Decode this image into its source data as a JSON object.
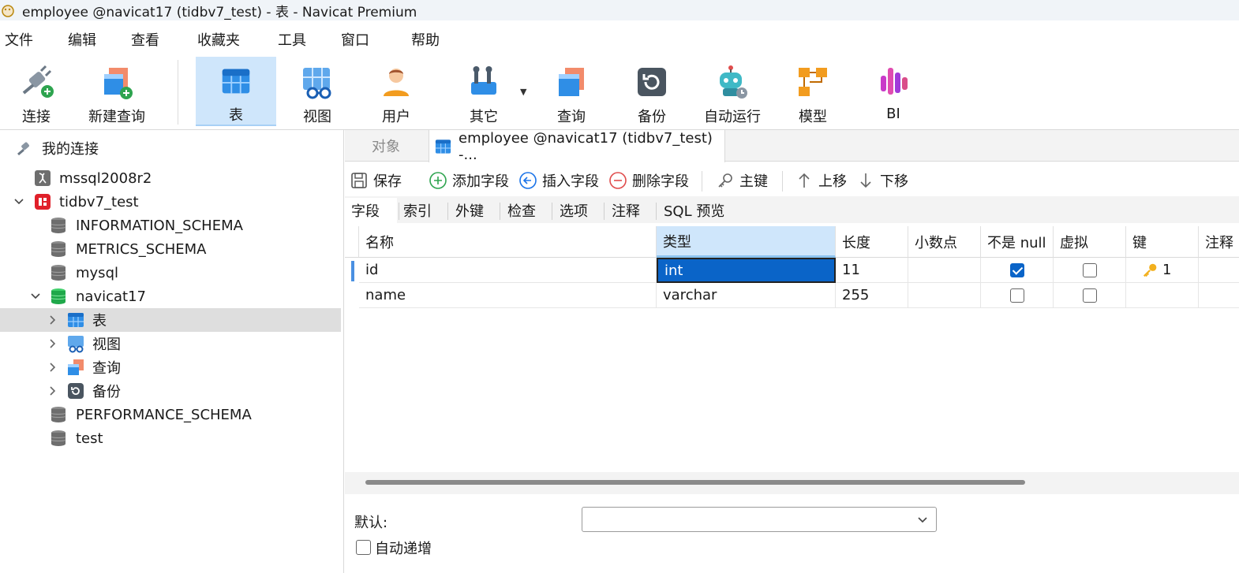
{
  "window": {
    "title": "employee @navicat17 (tidbv7_test) - 表 - Navicat Premium"
  },
  "menu": [
    "文件",
    "编辑",
    "查看",
    "收藏夹",
    "工具",
    "窗口",
    "帮助"
  ],
  "toolbar": {
    "connect": "连接",
    "new_query": "新建查询",
    "table": "表",
    "view": "视图",
    "user": "用户",
    "other": "其它",
    "query": "查询",
    "backup": "备份",
    "automation": "自动运行",
    "model": "模型",
    "bi": "BI"
  },
  "sidebar": {
    "root": "我的连接",
    "items": [
      {
        "label": "mssql2008r2"
      },
      {
        "label": "tidbv7_test"
      },
      {
        "label": "INFORMATION_SCHEMA"
      },
      {
        "label": "METRICS_SCHEMA"
      },
      {
        "label": "mysql"
      },
      {
        "label": "navicat17"
      },
      {
        "label": "表"
      },
      {
        "label": "视图"
      },
      {
        "label": "查询"
      },
      {
        "label": "备份"
      },
      {
        "label": "PERFORMANCE_SCHEMA"
      },
      {
        "label": "test"
      }
    ]
  },
  "tabs": {
    "objects": "对象",
    "editor": "employee @navicat17 (tidbv7_test) -..."
  },
  "actions": {
    "save": "保存",
    "add_field": "添加字段",
    "insert_field": "插入字段",
    "delete_field": "删除字段",
    "primary_key": "主键",
    "move_up": "上移",
    "move_down": "下移"
  },
  "subtabs": [
    "字段",
    "索引",
    "外键",
    "检查",
    "选项",
    "注释",
    "SQL 预览"
  ],
  "grid": {
    "headers": [
      "名称",
      "类型",
      "长度",
      "小数点",
      "不是 null",
      "虚拟",
      "键",
      "注释"
    ],
    "rows": [
      {
        "name": "id",
        "type": "int",
        "length": "11",
        "decimals": "",
        "not_null": true,
        "virtual": false,
        "key": "1"
      },
      {
        "name": "name",
        "type": "varchar",
        "length": "255",
        "decimals": "",
        "not_null": false,
        "virtual": false,
        "key": ""
      }
    ]
  },
  "props": {
    "default_label": "默认:",
    "default_value": "",
    "auto_increment_label": "自动递增"
  },
  "colors": {
    "accent": "#0a64c8",
    "active_toolbar": "#cfe6fb",
    "selected_tree": "#dedede"
  }
}
